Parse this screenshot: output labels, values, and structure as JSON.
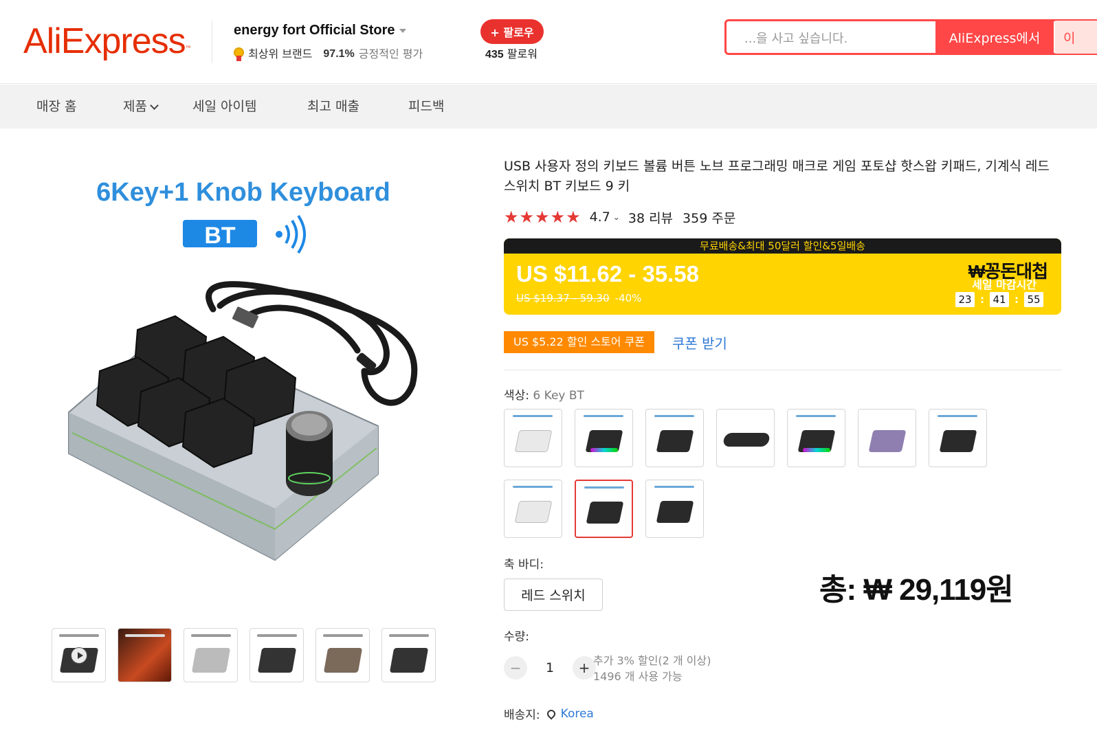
{
  "header": {
    "logo_text": "AliExpress",
    "logo_tm": "™",
    "store_name": "energy fort Official Store",
    "store_badge": "최상위 브랜드",
    "positive_pct": "97.1%",
    "positive_label": "긍정적인 평가",
    "follow_label": "+ 팔로우",
    "followers_count": "435",
    "followers_label": "팔로워",
    "search_placeholder": "...을 사고 싶습니다.",
    "search_btn_ali": "AliExpress에서",
    "search_btn_store": "이"
  },
  "nav": {
    "items": [
      {
        "label": "매장 홈"
      },
      {
        "label": "제품"
      },
      {
        "label": "세일 아이템"
      },
      {
        "label": "최고 매출"
      },
      {
        "label": "피드백"
      }
    ]
  },
  "gallery": {
    "headline": "6Key+1 Knob Keyboard",
    "badge": "BT",
    "thumbnails": 6
  },
  "product": {
    "title": "USB 사용자 정의 키보드 볼륨 버튼 노브 프로그래밍 매크로 게임 포토샵 핫스왑 키패드, 기계식 레드 스위치 BT 키보드 9 키",
    "stars": "★★★★★",
    "rating": "4.7",
    "rating_caret": "⌄",
    "reviews": "38 리뷰",
    "orders": "359 주문"
  },
  "promo": {
    "strip": "무료배송&최대 50달러 할인&5일배송",
    "price": "US $11.62 - 35.58",
    "original_price": "US $19.37 - 59.30",
    "discount": "-40%",
    "brand": "₩꽁돈대첩",
    "sale_end_label": "세일 마감시간",
    "timer": {
      "h": "23",
      "m": "41",
      "s": "55"
    }
  },
  "coupon": {
    "text": "US $5.22 할인 스토어 쿠폰",
    "action": "쿠폰 받기"
  },
  "options": {
    "color_label": "색상:",
    "color_value": "6 Key BT",
    "swatch_count": 10,
    "selected_swatch": 8,
    "axis_label": "축 바디:",
    "axis_value": "레드 스위치",
    "qty_label": "수량:",
    "qty_value": "1",
    "qty_minus": "−",
    "qty_plus": "+",
    "qty_note1": "추가 3% 할인(2 개 이상)",
    "qty_note2": "1496 개 사용 가능",
    "ship_label": "배송지:",
    "ship_value": "Korea"
  },
  "total": {
    "text": "총: ₩ 29,119원"
  },
  "colors": {
    "brand_red": "#e62e04",
    "accent_red": "#ff4747",
    "promo_yellow": "#ffd400",
    "coupon_orange": "#ff8a00",
    "link_blue": "#2e79d6",
    "bt_blue": "#1e88e5"
  }
}
